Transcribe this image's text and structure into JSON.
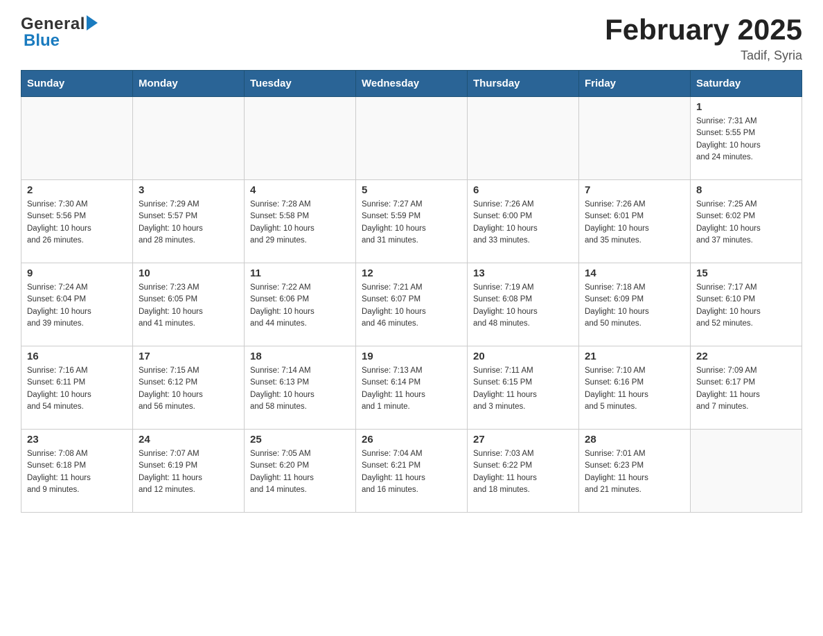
{
  "header": {
    "logo_general": "General",
    "logo_blue": "Blue",
    "month_title": "February 2025",
    "location": "Tadif, Syria"
  },
  "weekdays": [
    "Sunday",
    "Monday",
    "Tuesday",
    "Wednesday",
    "Thursday",
    "Friday",
    "Saturday"
  ],
  "weeks": [
    [
      {
        "day": "",
        "info": ""
      },
      {
        "day": "",
        "info": ""
      },
      {
        "day": "",
        "info": ""
      },
      {
        "day": "",
        "info": ""
      },
      {
        "day": "",
        "info": ""
      },
      {
        "day": "",
        "info": ""
      },
      {
        "day": "1",
        "info": "Sunrise: 7:31 AM\nSunset: 5:55 PM\nDaylight: 10 hours\nand 24 minutes."
      }
    ],
    [
      {
        "day": "2",
        "info": "Sunrise: 7:30 AM\nSunset: 5:56 PM\nDaylight: 10 hours\nand 26 minutes."
      },
      {
        "day": "3",
        "info": "Sunrise: 7:29 AM\nSunset: 5:57 PM\nDaylight: 10 hours\nand 28 minutes."
      },
      {
        "day": "4",
        "info": "Sunrise: 7:28 AM\nSunset: 5:58 PM\nDaylight: 10 hours\nand 29 minutes."
      },
      {
        "day": "5",
        "info": "Sunrise: 7:27 AM\nSunset: 5:59 PM\nDaylight: 10 hours\nand 31 minutes."
      },
      {
        "day": "6",
        "info": "Sunrise: 7:26 AM\nSunset: 6:00 PM\nDaylight: 10 hours\nand 33 minutes."
      },
      {
        "day": "7",
        "info": "Sunrise: 7:26 AM\nSunset: 6:01 PM\nDaylight: 10 hours\nand 35 minutes."
      },
      {
        "day": "8",
        "info": "Sunrise: 7:25 AM\nSunset: 6:02 PM\nDaylight: 10 hours\nand 37 minutes."
      }
    ],
    [
      {
        "day": "9",
        "info": "Sunrise: 7:24 AM\nSunset: 6:04 PM\nDaylight: 10 hours\nand 39 minutes."
      },
      {
        "day": "10",
        "info": "Sunrise: 7:23 AM\nSunset: 6:05 PM\nDaylight: 10 hours\nand 41 minutes."
      },
      {
        "day": "11",
        "info": "Sunrise: 7:22 AM\nSunset: 6:06 PM\nDaylight: 10 hours\nand 44 minutes."
      },
      {
        "day": "12",
        "info": "Sunrise: 7:21 AM\nSunset: 6:07 PM\nDaylight: 10 hours\nand 46 minutes."
      },
      {
        "day": "13",
        "info": "Sunrise: 7:19 AM\nSunset: 6:08 PM\nDaylight: 10 hours\nand 48 minutes."
      },
      {
        "day": "14",
        "info": "Sunrise: 7:18 AM\nSunset: 6:09 PM\nDaylight: 10 hours\nand 50 minutes."
      },
      {
        "day": "15",
        "info": "Sunrise: 7:17 AM\nSunset: 6:10 PM\nDaylight: 10 hours\nand 52 minutes."
      }
    ],
    [
      {
        "day": "16",
        "info": "Sunrise: 7:16 AM\nSunset: 6:11 PM\nDaylight: 10 hours\nand 54 minutes."
      },
      {
        "day": "17",
        "info": "Sunrise: 7:15 AM\nSunset: 6:12 PM\nDaylight: 10 hours\nand 56 minutes."
      },
      {
        "day": "18",
        "info": "Sunrise: 7:14 AM\nSunset: 6:13 PM\nDaylight: 10 hours\nand 58 minutes."
      },
      {
        "day": "19",
        "info": "Sunrise: 7:13 AM\nSunset: 6:14 PM\nDaylight: 11 hours\nand 1 minute."
      },
      {
        "day": "20",
        "info": "Sunrise: 7:11 AM\nSunset: 6:15 PM\nDaylight: 11 hours\nand 3 minutes."
      },
      {
        "day": "21",
        "info": "Sunrise: 7:10 AM\nSunset: 6:16 PM\nDaylight: 11 hours\nand 5 minutes."
      },
      {
        "day": "22",
        "info": "Sunrise: 7:09 AM\nSunset: 6:17 PM\nDaylight: 11 hours\nand 7 minutes."
      }
    ],
    [
      {
        "day": "23",
        "info": "Sunrise: 7:08 AM\nSunset: 6:18 PM\nDaylight: 11 hours\nand 9 minutes."
      },
      {
        "day": "24",
        "info": "Sunrise: 7:07 AM\nSunset: 6:19 PM\nDaylight: 11 hours\nand 12 minutes."
      },
      {
        "day": "25",
        "info": "Sunrise: 7:05 AM\nSunset: 6:20 PM\nDaylight: 11 hours\nand 14 minutes."
      },
      {
        "day": "26",
        "info": "Sunrise: 7:04 AM\nSunset: 6:21 PM\nDaylight: 11 hours\nand 16 minutes."
      },
      {
        "day": "27",
        "info": "Sunrise: 7:03 AM\nSunset: 6:22 PM\nDaylight: 11 hours\nand 18 minutes."
      },
      {
        "day": "28",
        "info": "Sunrise: 7:01 AM\nSunset: 6:23 PM\nDaylight: 11 hours\nand 21 minutes."
      },
      {
        "day": "",
        "info": ""
      }
    ]
  ]
}
